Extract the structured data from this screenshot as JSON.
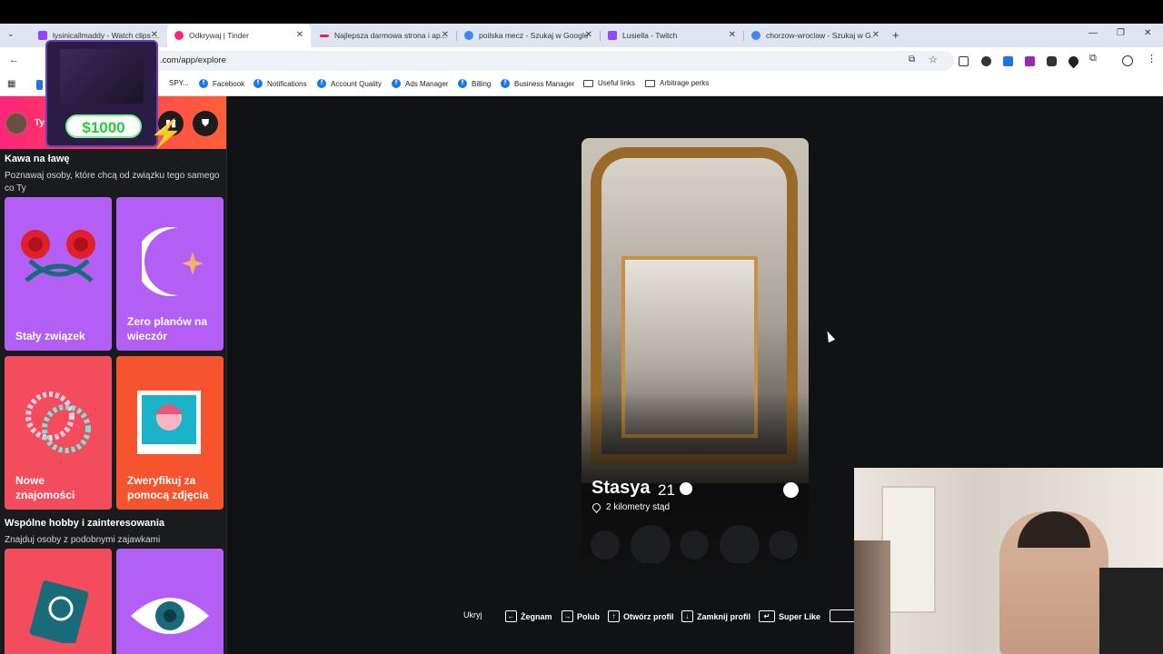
{
  "browser": {
    "tabs": [
      {
        "title": "lysinicallmaddy - Watch clips ...",
        "favicon_color": "#9146ff",
        "active": false
      },
      {
        "title": "Odkrywaj | Tinder",
        "favicon_color": "#fd267a",
        "active": true
      },
      {
        "title": "Najlepsza darmowa strona i ap...",
        "favicon_color": "#e91e63",
        "active": false
      },
      {
        "title": "poilska mecz - Szukaj w Google",
        "favicon_color": "#4285f4",
        "active": false
      },
      {
        "title": "Lusiella - Twitch",
        "favicon_color": "#9146ff",
        "active": false
      },
      {
        "title": "chorzow-wroclaw - Szukaj w G...",
        "favicon_color": "#4285f4",
        "active": false
      }
    ],
    "new_tab": "+",
    "url": ".com/app/explore",
    "bookmarks": [
      {
        "label": "SPY...",
        "type": "folder"
      },
      {
        "label": "Facebook",
        "type": "fb"
      },
      {
        "label": "Notifications",
        "type": "fb"
      },
      {
        "label": "Account Quality",
        "type": "fb"
      },
      {
        "label": "Ads Manager",
        "type": "fb"
      },
      {
        "label": "Billing",
        "type": "fb"
      },
      {
        "label": "Business Manager",
        "type": "fb"
      },
      {
        "label": "Useful links",
        "type": "folder"
      },
      {
        "label": "Arbitrage perks",
        "type": "folder"
      }
    ]
  },
  "overlay": {
    "price": "$1000"
  },
  "sidebar": {
    "user_name": "Ty",
    "sections": [
      {
        "title": "Kawa na ławę",
        "subtitle": "Poznawaj osoby, które chcą od związku tego samego co Ty",
        "cards": [
          {
            "label": "Stały związek",
            "color": "#b35ff5",
            "icon": "roses-icon"
          },
          {
            "label": "Zero planów na wieczór",
            "color": "#b35ff5",
            "icon": "moon-icon"
          },
          {
            "label": "Nowe znajomości",
            "color": "#f34c5c",
            "icon": "bracelets-icon"
          },
          {
            "label": "Zweryfikuj za pomocą zdjęcia",
            "color": "#f6542e",
            "icon": "photo-verify-icon"
          }
        ]
      },
      {
        "title": "Wspólne hobby i zainteresowania",
        "subtitle": "Znajduj osoby z podobnymi zajawkami",
        "cards": [
          {
            "label": "",
            "color": "#f34c5c",
            "icon": "passport-icon"
          },
          {
            "label": "",
            "color": "#b35ff5",
            "icon": "eye-icon"
          }
        ]
      }
    ]
  },
  "profile": {
    "name": "Stasya",
    "age": "21",
    "distance": "2 kilometry stąd"
  },
  "shortcuts": {
    "hide": "Ukryj",
    "items": [
      "Żegnam",
      "Polub",
      "Otwórz profil",
      "Zamknij profil",
      "Super Like"
    ]
  }
}
